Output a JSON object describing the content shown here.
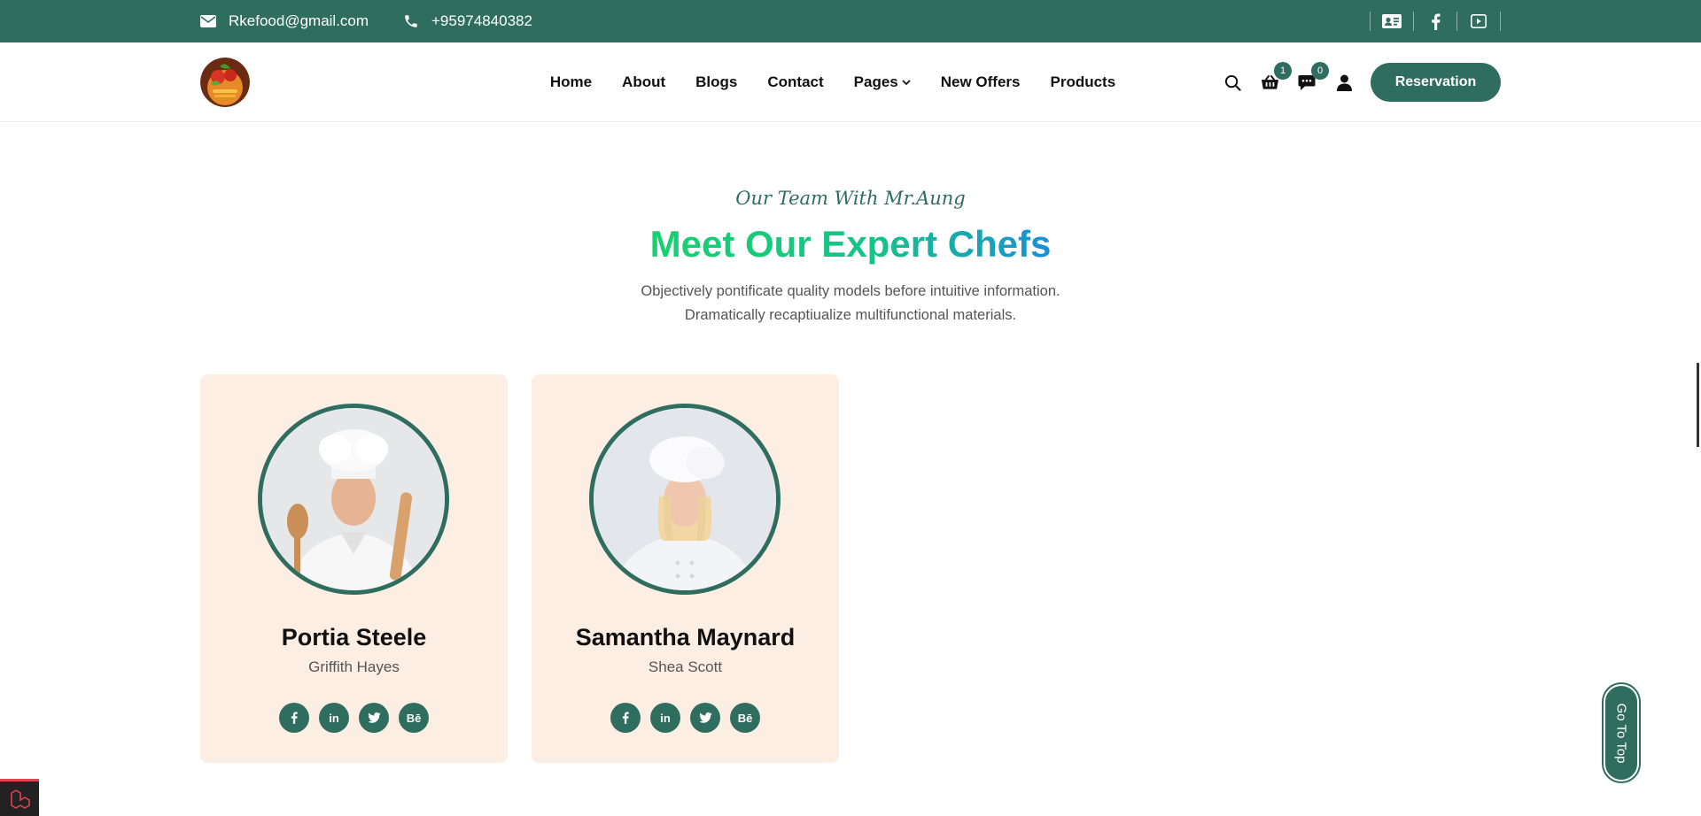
{
  "topbar": {
    "email": "Rkefood@gmail.com",
    "phone": "+95974840382",
    "social_icons": [
      "id-card-icon",
      "facebook-icon",
      "youtube-icon"
    ]
  },
  "nav": {
    "items": [
      "Home",
      "About",
      "Blogs",
      "Contact",
      "Pages",
      "New Offers",
      "Products"
    ],
    "cart_count": "1",
    "chat_count": "0",
    "reservation_label": "Reservation"
  },
  "section": {
    "subtitle": "Our Team With Mr.Aung",
    "title": "Meet Our Expert Chefs",
    "desc_line1": "Objectively pontificate quality models before intuitive information.",
    "desc_line2": "Dramatically recaptiualize multifunctional materials."
  },
  "chefs": [
    {
      "name": "Portia Steele",
      "role": "Griffith Hayes"
    },
    {
      "name": "Samantha Maynard",
      "role": "Shea Scott"
    }
  ],
  "card_social": [
    "facebook-icon",
    "linkedin-icon",
    "twitter-icon",
    "behance-icon"
  ],
  "behance_label": "Bē",
  "linkedin_label": "in",
  "go_top_label": "Go To Top",
  "colors": {
    "primary": "#2f6e5f",
    "card_bg": "#fdeee3",
    "gradient_start": "#19d16d",
    "gradient_end": "#1a8fd6"
  }
}
